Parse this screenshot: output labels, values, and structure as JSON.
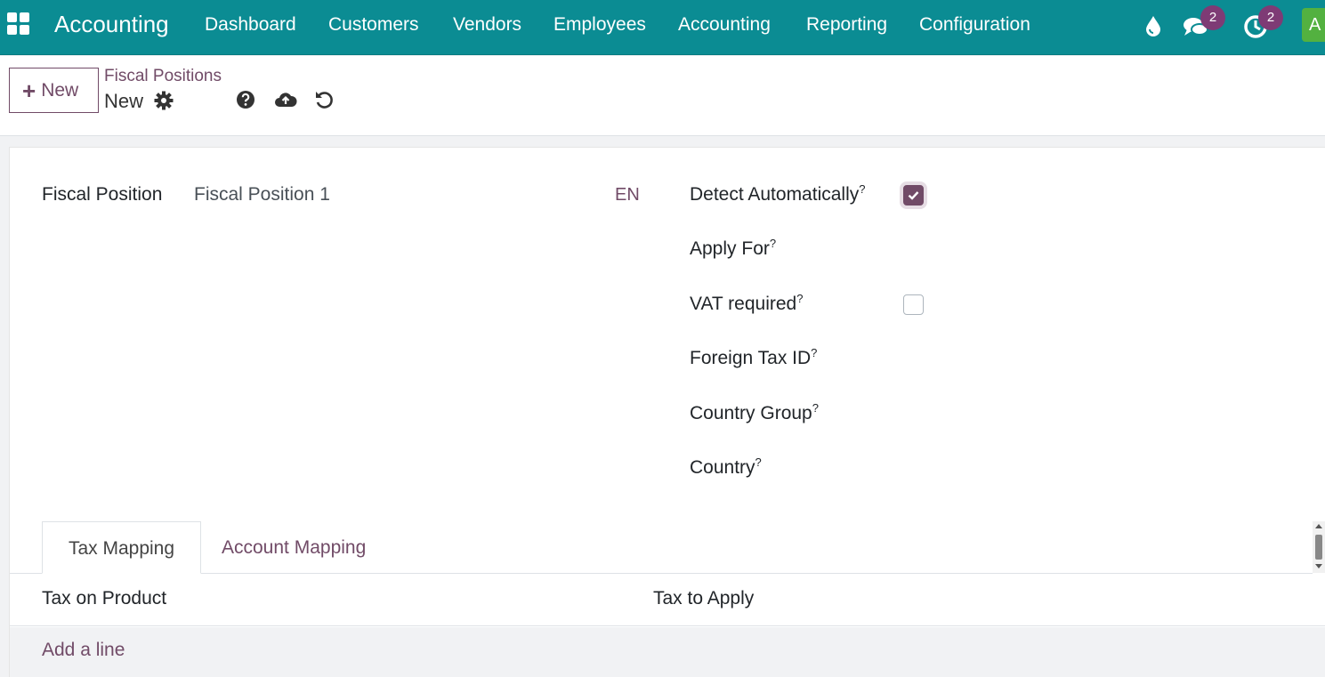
{
  "navbar": {
    "brand": "Accounting",
    "menu": [
      "Dashboard",
      "Customers",
      "Vendors",
      "Employees",
      "Accounting",
      "Reporting",
      "Configuration"
    ],
    "chat_badge": "2",
    "activity_badge": "2",
    "avatar_letter": "A",
    "icons": [
      "apps-grid-icon",
      "droplet-icon",
      "chat-icon",
      "clock-icon"
    ]
  },
  "control": {
    "new_label": "New",
    "breadcrumb_parent": "Fiscal Positions",
    "breadcrumb_current": "New",
    "icons": [
      "gear-icon",
      "help-icon",
      "cloud-upload-icon",
      "undo-icon"
    ]
  },
  "form": {
    "fiscal_position_label": "Fiscal Position",
    "fiscal_position_value": "Fiscal Position 1",
    "lang": "EN",
    "detect_automatically_label": "Detect Automatically",
    "detect_automatically_checked": true,
    "apply_for_label": "Apply For",
    "vat_required_label": "VAT required",
    "vat_required_checked": false,
    "foreign_tax_id_label": "Foreign Tax ID",
    "country_group_label": "Country Group",
    "country_label": "Country",
    "help_mark": "?"
  },
  "tabs": [
    "Tax Mapping",
    "Account Mapping"
  ],
  "table": {
    "columns": [
      "Tax on Product",
      "Tax to Apply"
    ],
    "add_line": "Add a line"
  },
  "colors": {
    "navbar": "#0b8c93",
    "accent": "#714b67",
    "avatar": "#53b140"
  }
}
